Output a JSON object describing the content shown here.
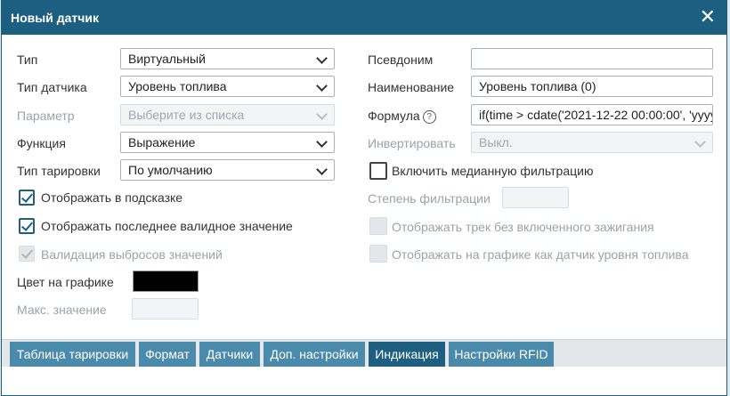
{
  "dialog": {
    "title": "Новый датчик",
    "close_icon": "close-icon"
  },
  "left": {
    "type": {
      "label": "Тип",
      "value": "Виртуальный"
    },
    "sensor_type": {
      "label": "Тип датчика",
      "value": "Уровень топлива"
    },
    "parameter": {
      "label": "Параметр",
      "placeholder": "Выберите из списка"
    },
    "function": {
      "label": "Функция",
      "value": "Выражение"
    },
    "calibration_type": {
      "label": "Тип тарировки",
      "value": "По умолчанию"
    },
    "show_in_tooltip": {
      "label": "Отображать в подсказке",
      "checked": true
    },
    "show_last_valid": {
      "label": "Отображать последнее валидное значение",
      "checked": true
    },
    "outlier_validation": {
      "label": "Валидация выбросов значений",
      "checked": true,
      "disabled": true
    },
    "chart_color": {
      "label": "Цвет на графике",
      "color": "#000000"
    },
    "max_value": {
      "label": "Макс. значение",
      "value": ""
    }
  },
  "right": {
    "alias": {
      "label": "Псевдоним",
      "value": ""
    },
    "name": {
      "label": "Наименование",
      "value": "Уровень топлива (0)"
    },
    "formula": {
      "label": "Формула",
      "value": "if(time > cdate('2021-12-22 00:00:00', 'yyyy"
    },
    "invert": {
      "label": "Инвертировать",
      "value": "Выкл."
    },
    "median_filter": {
      "label": "Включить медианную фильтрацию",
      "checked": false
    },
    "filter_degree": {
      "label": "Степень фильтрации",
      "value": ""
    },
    "track_no_ignition": {
      "label": "Отображать трек без включенного зажигания",
      "checked": false,
      "disabled": true
    },
    "show_as_fuel": {
      "label": "Отображать на графике как датчик уровня топлива",
      "checked": false,
      "disabled": true
    }
  },
  "tabs": [
    {
      "label": "Таблица тарировки"
    },
    {
      "label": "Формат"
    },
    {
      "label": "Датчики"
    },
    {
      "label": "Доп. настройки"
    },
    {
      "label": "Индикация"
    },
    {
      "label": "Настройки RFID"
    }
  ],
  "colors": {
    "header": "#1d5f80",
    "tab": "#4a8aab",
    "tab_active": "#1d5f80"
  }
}
